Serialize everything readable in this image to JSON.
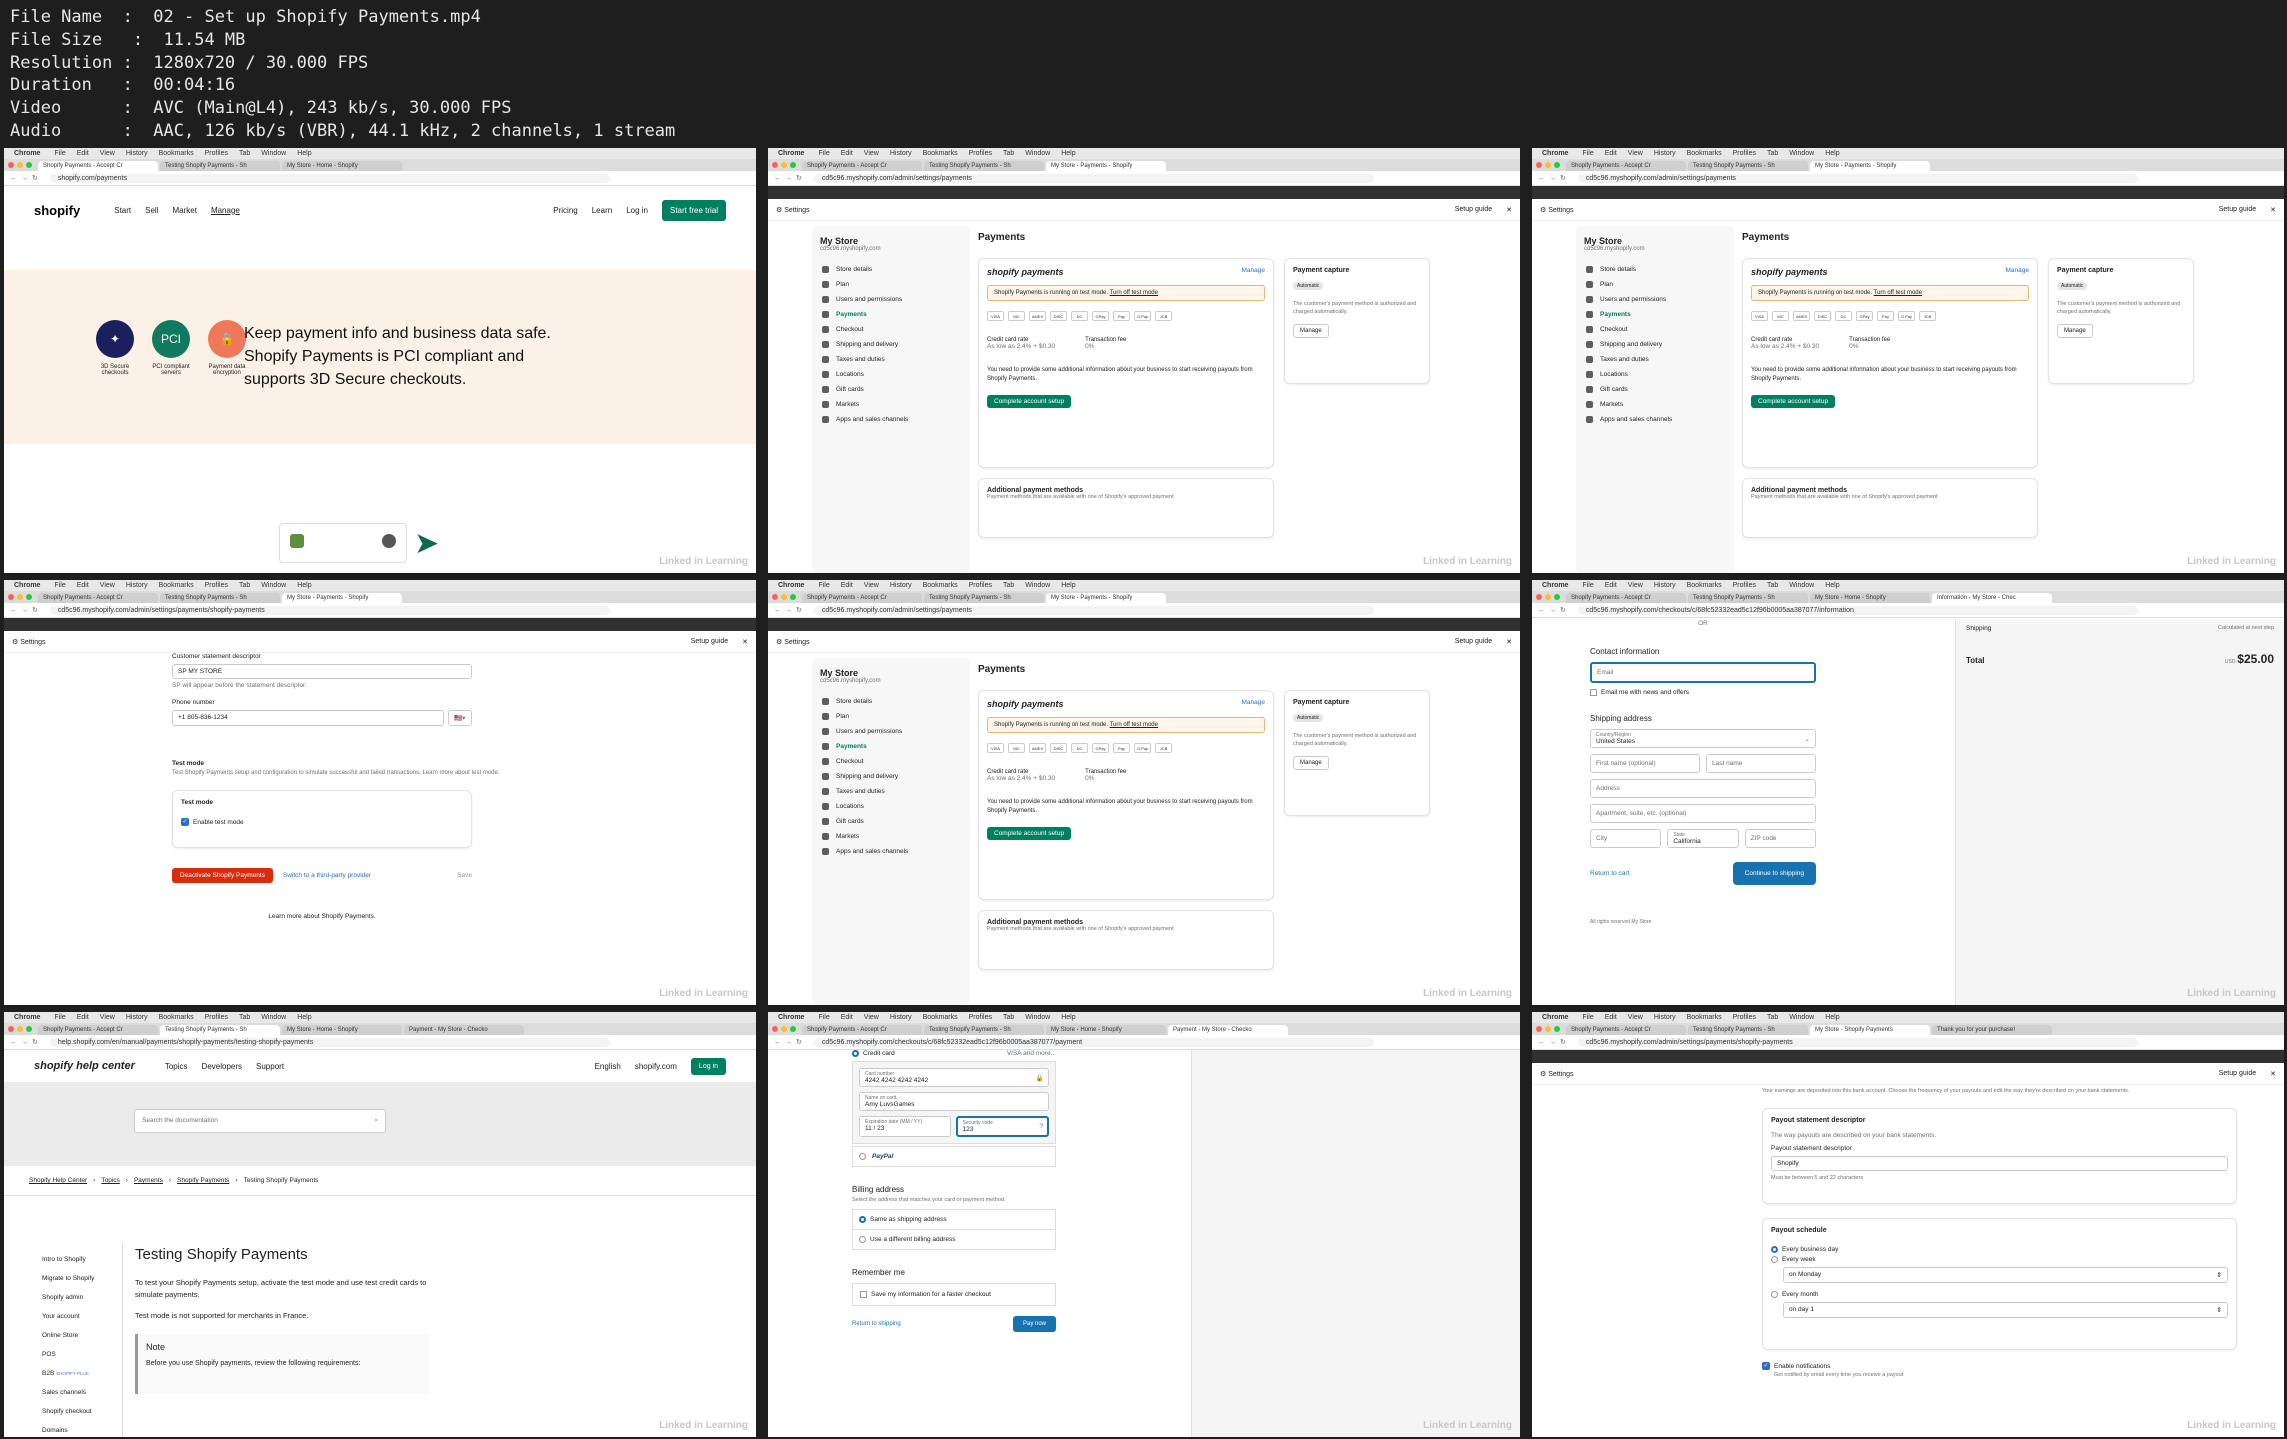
{
  "info": {
    "file_name": "File Name  :  02 - Set up Shopify Payments.mp4",
    "file_size": "File Size   :  11.54 MB",
    "resolution": "Resolution :  1280x720 / 30.000 FPS",
    "duration": "Duration   :  00:04:16",
    "video": "Video      :  AVC (Main@L4), 243 kb/s, 30.000 FPS",
    "audio": "Audio      :  AAC, 126 kb/s (VBR), 44.1 kHz, 2 channels, 1 stream"
  },
  "menubar": {
    "chrome": "Chrome",
    "items": [
      "File",
      "Edit",
      "View",
      "History",
      "Bookmarks",
      "Profiles",
      "Tab",
      "Window",
      "Help"
    ]
  },
  "watermark": "Linked in Learning",
  "t1": {
    "tabs": [
      "Shopify Payments - Accept Cr",
      "Testing Shopify Payments - Sh",
      "My Store - Home - Shopify"
    ],
    "url": "shopify.com/payments",
    "logo": "shopify",
    "nav": [
      "Start",
      "Sell",
      "Market",
      "Manage"
    ],
    "nav_right": [
      "Pricing",
      "Learn",
      "Log in"
    ],
    "cta": "Start free trial",
    "icons": [
      {
        "label": "3D Secure checkouts",
        "color": "#1b1f5e"
      },
      {
        "label": "PCI compliant servers",
        "color": "#0f7a5f",
        "glyph": "PCI"
      },
      {
        "label": "Payment data encryption",
        "color": "#f0775a"
      }
    ],
    "headline": "Keep payment info and business data safe. Shopify Payments is PCI compliant and supports 3D Secure checkouts."
  },
  "admin": {
    "tabs": [
      "Shopify Payments - Accept Cr",
      "Testing Shopify Payments - Sh",
      "My Store - Payments - Shopify"
    ],
    "url": "cd5c96.myshopify.com/admin/settings/payments",
    "settings": "Settings",
    "setup_guide": "Setup guide",
    "store": "My Store",
    "domain": "cd5c96.myshopify.com",
    "menu": [
      "Store details",
      "Plan",
      "Users and permissions",
      "Payments",
      "Checkout",
      "Shipping and delivery",
      "Taxes and duties",
      "Locations",
      "Gift cards",
      "Markets",
      "Apps and sales channels"
    ],
    "page_title": "Payments",
    "provider": "shopify payments",
    "manage": "Manage",
    "notice": "Shopify Payments is running on test mode.",
    "notice_link": "Turn off test mode",
    "card_brands": [
      "VISA",
      "MC",
      "AMEX",
      "DISC",
      "DC",
      "GPay",
      "Pay",
      "G Pay",
      "JCB"
    ],
    "cc_rate_label": "Credit card rate",
    "cc_rate": "As low as 2.4% + $0.30",
    "fee_label": "Transaction fee",
    "fee": "0%",
    "info_text": "You need to provide some additional information about your business to start receiving payouts from Shopify Payments.",
    "complete": "Complete account setup",
    "capture_title": "Payment capture",
    "capture_badge": "Automatic",
    "capture_text": "The customer's payment method is authorized and charged automatically.",
    "capture_btn": "Manage",
    "additional": "Additional payment methods",
    "additional_sub": "Payment methods that are available with one of Shopify's approved payment"
  },
  "t4": {
    "url": "cd5c96.myshopify.com/admin/settings/payments/shopify-payments",
    "descriptor_label": "Customer statement descriptor",
    "descriptor_value": "SP  MY STORE",
    "descriptor_note": "SP will appear before the statement descriptor.",
    "phone_label": "Phone number",
    "phone_value": "+1 805-836-1234",
    "test_title": "Test mode",
    "test_desc": "Test Shopify Payments setup and configuration to simulate successful and failed transactions. Learn more about test mode.",
    "test_card_title": "Test mode",
    "enable_label": "Enable test mode",
    "deactivate": "Deactivate Shopify Payments",
    "switch": "Switch to a third-party provider",
    "save": "Save",
    "learn": "Learn more about Shopify Payments."
  },
  "t6": {
    "tabs": [
      "Shopify Payments - Accept Cr",
      "Testing Shopify Payments - Sh",
      "My Store - Home - Shopify",
      "Information - My Store - Chec"
    ],
    "url": "cd5c96.myshopify.com/checkouts/c/68fc52332ead5c12f96b0005aa387077/information",
    "or": "OR",
    "contact": "Contact information",
    "email": "Email",
    "news": "Email me with news and offers",
    "shipping": "Shipping address",
    "country_label": "Country/Region",
    "country": "United States",
    "first": "First name (optional)",
    "last": "Last name",
    "address": "Address",
    "apt": "Apartment, suite, etc. (optional)",
    "city": "City",
    "state_label": "State",
    "state": "California",
    "zip": "ZIP code",
    "return": "Return to cart",
    "continue": "Continue to shipping",
    "rights": "All rights reserved My Store",
    "ship_label": "Shipping",
    "ship_value": "Calculated at next step",
    "total_label": "Total",
    "currency": "USD",
    "total": "$25.00"
  },
  "t7": {
    "tabs": [
      "Shopify Payments - Accept Cr",
      "Testing Shopify Payments - Sh",
      "My Store - Home - Shopify",
      "Payment - My Store - Checko"
    ],
    "url": "help.shopify.com/en/manual/payments/shopify-payments/testing-shopify-payments",
    "logo": "shopify help center",
    "nav": [
      "Topics",
      "Developers",
      "Support"
    ],
    "lang": "English",
    "site": "shopify.com",
    "login": "Log in",
    "search": "Search the documentation",
    "crumbs": [
      "Shopify Help Center",
      "Topics",
      "Payments",
      "Shopify Payments",
      "Testing Shopify Payments"
    ],
    "side": [
      "Intro to Shopify",
      "Migrate to Shopify",
      "Shopify admin",
      "Your account",
      "Online Store",
      "POS",
      "B2B",
      "Sales channels",
      "Shopify checkout",
      "Domains"
    ],
    "plus": "SHOPIFY PLUS",
    "title": "Testing Shopify Payments",
    "p1": "To test your Shopify Payments setup, activate the test mode and use test credit cards to simulate payments.",
    "p2": "Test mode is not supported for merchants in France.",
    "note": "Note",
    "note_text": "Before you use Shopify payments, review the following requirements:"
  },
  "t8": {
    "url": "cd5c96.myshopify.com/checkouts/c/68fc52332ead5c12f96b0005aa387077/payment",
    "credit": "Credit card",
    "more": "and more...",
    "card_label": "Card number",
    "card": "4242 4242 4242 4242",
    "name_label": "Name on card",
    "name": "Amy LuvsGames",
    "exp_label": "Expiration date (MM / YY)",
    "exp": "11 / 23",
    "cvc_label": "Security code",
    "cvc": "123",
    "paypal": "PayPal",
    "billing": "Billing address",
    "billing_sub": "Select the address that matches your card or payment method.",
    "same": "Same as shipping address",
    "diff": "Use a different billing address",
    "remember": "Remember me",
    "save_info": "Save my information for a faster checkout",
    "back": "Return to shipping",
    "pay": "Pay now"
  },
  "t9": {
    "tabs": [
      "Shopify Payments - Accept Cr",
      "Testing Shopify Payments - Sh",
      "My Store - Shopify Payments",
      "Thank you for your purchase!"
    ],
    "url": "cd5c96.myshopify.com/admin/settings/payments/shopify-payments",
    "payout_note": "Your earnings are deposited into this bank account. Choose the frequency of your payouts and edit the way they're described on your bank statements.",
    "psd_title": "Payout statement descriptor",
    "psd_sub": "The way payouts are described on your bank statements.",
    "psd_label": "Payout statement descriptor",
    "psd_value": "Shopify",
    "psd_hint": "Must be between 5 and 22 characters",
    "sched_title": "Payout schedule",
    "opt_day": "Every business day",
    "opt_week": "Every week",
    "week_val": "on Monday",
    "opt_month": "Every month",
    "month_val": "on day 1",
    "notif": "Enable notifications",
    "notif_sub": "Get notified by email every time you receive a payout"
  }
}
